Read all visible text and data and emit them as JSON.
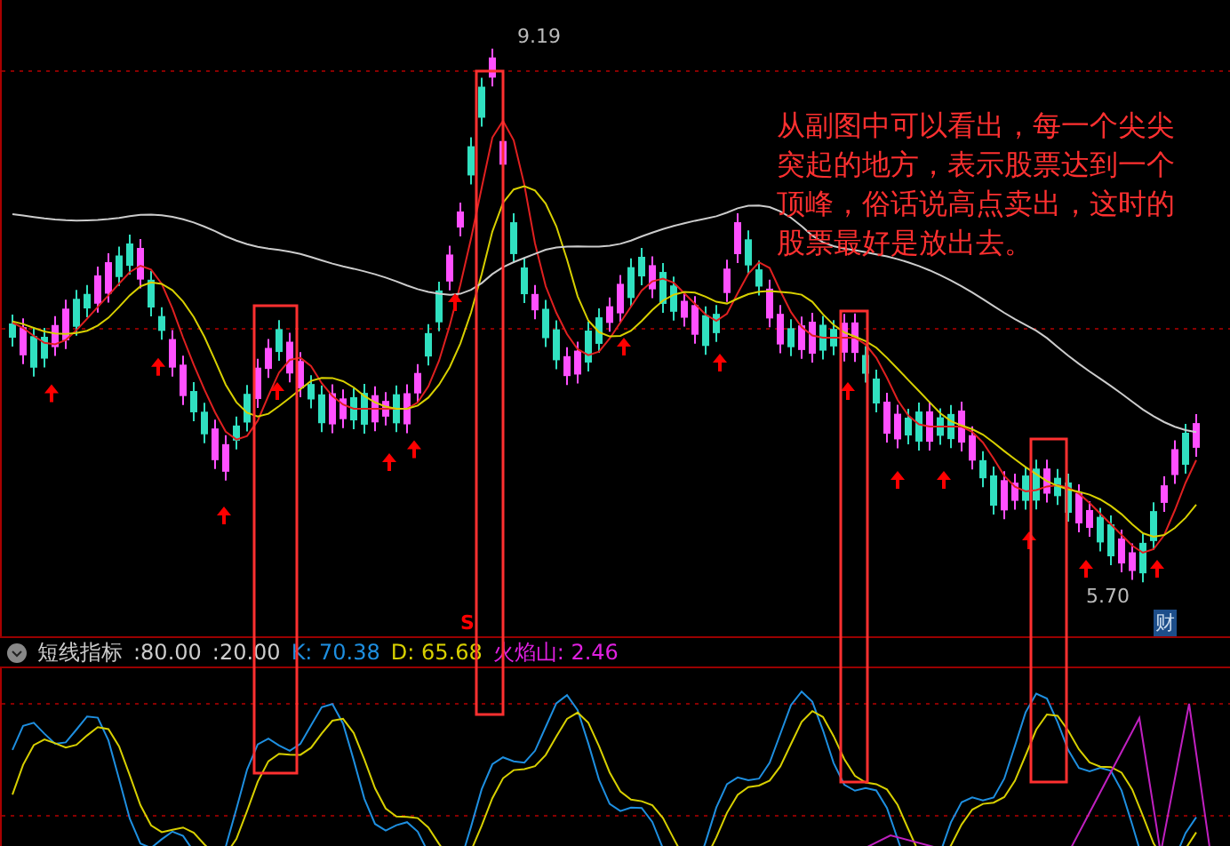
{
  "chart": {
    "high_label": "9.19",
    "low_label": "5.70",
    "event_marker": "财",
    "sell_marker": "S",
    "annotation": "从副图中可以看出，每一个尖尖突起的地方，表示股票达到一个顶峰，俗话说高点卖出，这时的股票最好是放出去。"
  },
  "indicator": {
    "name": "短线指标",
    "params": [
      ":80.00",
      ":20.00"
    ],
    "values": [
      {
        "label": "K: 70.38",
        "color": "#1e8fe0"
      },
      {
        "label": "D: 65.68",
        "color": "#d8d000"
      },
      {
        "label": "火焰山: 2.46",
        "color": "#e020e0"
      }
    ]
  }
}
